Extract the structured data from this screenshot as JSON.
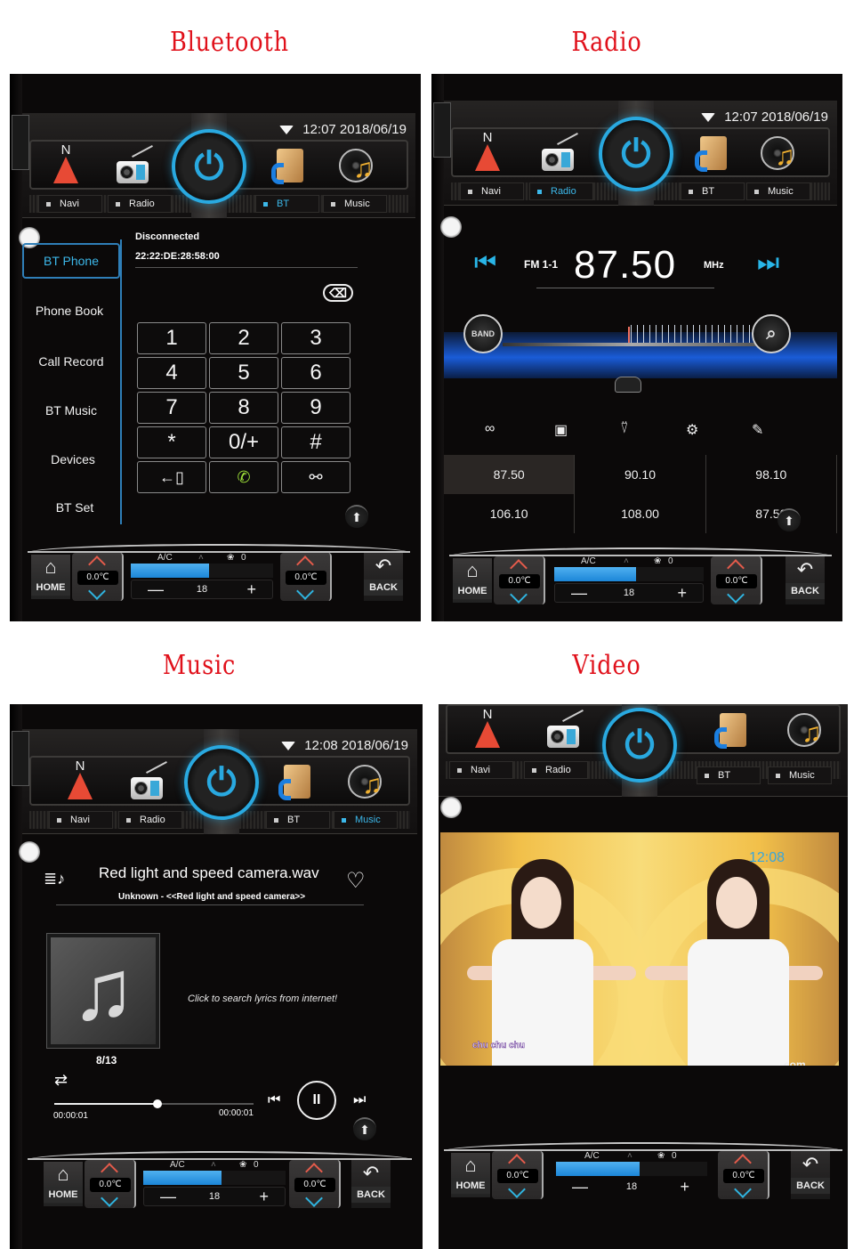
{
  "captions": {
    "bluetooth": "Bluetooth",
    "radio": "Radio",
    "music": "Music",
    "video": "Video"
  },
  "common": {
    "nav": [
      "Navi",
      "Radio",
      "BT",
      "Music"
    ],
    "icons": [
      "compass-icon",
      "radio-icon",
      "power-icon",
      "bt-phonebook-icon",
      "music-disc-icon"
    ],
    "power_glyph": "⏻",
    "climate": {
      "ac_label": "A/C",
      "fan_label": "0",
      "fan_glyph": "❀",
      "fan_up_glyph": "˄",
      "left_temp": "0.0℃",
      "right_temp": "0.0℃",
      "level": "18",
      "level_fill_fraction": 0.55,
      "minus": "—",
      "plus": "+",
      "home_label": "HOME",
      "back_label": "BACK",
      "home_glyph": "⌂",
      "back_glyph": "↶"
    },
    "accent": "#29a9e0",
    "up_arrow": "⬆"
  },
  "bluetooth": {
    "status_time": "12:07 2018/06/19",
    "active_nav": "BT",
    "connection_status": "Disconnected",
    "device_address": "22:22:DE:28:58:00",
    "sidebar": [
      "BT Phone",
      "Phone Book",
      "Call Record",
      "BT Music",
      "Devices",
      "BT Set"
    ],
    "active_sidebar": "BT Phone",
    "backspace_glyph": "⌫",
    "keys": [
      "1",
      "2",
      "3",
      "4",
      "5",
      "6",
      "7",
      "8",
      "9",
      "*",
      "0/+",
      "#"
    ],
    "action_keys": [
      {
        "name": "transfer-to-phone",
        "glyph": "←▯"
      },
      {
        "name": "call",
        "glyph": "✆"
      },
      {
        "name": "link",
        "glyph": "⚯"
      }
    ]
  },
  "radio": {
    "status_time": "12:07 2018/06/19",
    "active_nav": "Radio",
    "band": "FM 1-1",
    "frequency": "87.50",
    "unit": "MHz",
    "prev_glyph": "⏮",
    "next_glyph": "⏭",
    "band_button": "BAND",
    "scan_glyph": "⌕",
    "tuner_position_fraction": 0.0,
    "tools": [
      {
        "name": "stereo-icon",
        "glyph": "∞"
      },
      {
        "name": "save-icon",
        "glyph": "▣"
      },
      {
        "name": "antenna-icon",
        "glyph": "⍢"
      },
      {
        "name": "settings-icon",
        "glyph": "⚙"
      },
      {
        "name": "edit-icon",
        "glyph": "✎"
      }
    ],
    "presets": [
      "87.50",
      "90.10",
      "98.10",
      "106.10",
      "108.00",
      "87.50"
    ],
    "selected_preset": 0
  },
  "music": {
    "status_time": "12:08 2018/06/19",
    "active_nav": "Music",
    "title": "Red light and speed camera.wav",
    "subtitle": "Unknown - <<Red light and speed camera>>",
    "playlist_glyph": "≣♪",
    "favorite_glyph": "♡",
    "album_glyph": "♫",
    "lyrics_hint": "Click to search lyrics from internet!",
    "track_index": "8/13",
    "repeat_glyph": "⇄",
    "elapsed": "00:00:01",
    "duration": "00:00:01",
    "progress_fraction": 0.52,
    "prev_glyph": "⏮",
    "pause_glyph": "II",
    "next_glyph": "⏭"
  },
  "video": {
    "active_nav": "",
    "overlay_clock": "12:08",
    "lyric": "chu chu chu",
    "channel_logo": "com"
  }
}
